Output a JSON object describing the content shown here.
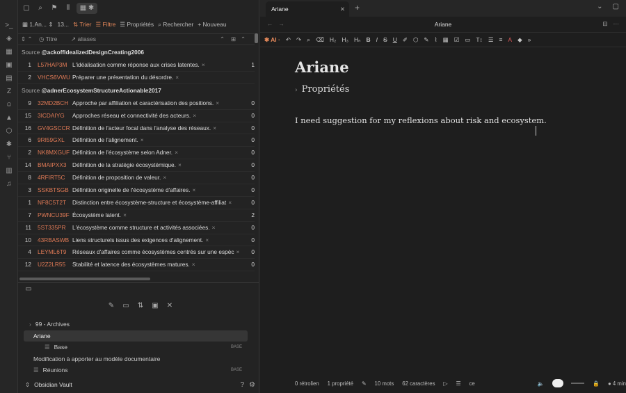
{
  "left_panel": {
    "bases_tab_label": "1.An...",
    "count_label": "13...",
    "toolbar": {
      "sort": "Trier",
      "filter": "Filtre",
      "properties": "Propriétés",
      "search": "Rechercher",
      "new": "Nouveau"
    },
    "columns": {
      "title": "Titre",
      "aliases": "aliases"
    },
    "groups": [
      {
        "source_label": "Source",
        "source_name": "@ackoffIdealizedDesignCreating2006",
        "rows": [
          {
            "n": "1",
            "id": "L57HAP3M",
            "title": "L'idéalisation comme réponse aux crises latentes.",
            "count": "1"
          },
          {
            "n": "2",
            "id": "VHCS6VWU",
            "title": "Préparer une présentation du désordre.",
            "count": ""
          }
        ]
      },
      {
        "source_label": "Source",
        "source_name": "@adnerEcosystemStructureActionable2017",
        "rows": [
          {
            "n": "9",
            "id": "32MD2BCH",
            "title": "Approche par affiliation et caractérisation des positions.",
            "count": "0"
          },
          {
            "n": "15",
            "id": "3ICDAIYG",
            "title": "Approches réseau et connectivité des acteurs.",
            "count": "0"
          },
          {
            "n": "16",
            "id": "GV4GSCCR",
            "title": "Définition de l'acteur focal dans l'analyse des réseaux.",
            "count": "0"
          },
          {
            "n": "6",
            "id": "9RI59GXL",
            "title": "Définition de l'alignement.",
            "count": "0"
          },
          {
            "n": "2",
            "id": "NK8MXGUF",
            "title": "Définition de l'écosystème selon Adner.",
            "count": "0"
          },
          {
            "n": "14",
            "id": "BMAIPXX3",
            "title": "Définition de la stratégie écosystémique.",
            "count": "0"
          },
          {
            "n": "8",
            "id": "4RFIRT5C",
            "title": "Définition de proposition de valeur.",
            "count": "0"
          },
          {
            "n": "3",
            "id": "SSKBTSGB",
            "title": "Définition originelle de l'écosystème d'affaires.",
            "count": "0"
          },
          {
            "n": "1",
            "id": "NF8C5T2T",
            "title": "Distinction entre écosystème-structure et écosystème-affiliat",
            "count": "0"
          },
          {
            "n": "7",
            "id": "PWNCU39F",
            "title": "Écosystème latent.",
            "count": "2"
          },
          {
            "n": "11",
            "id": "5ST335PR",
            "title": "L'écosystème comme structure et activités associées.",
            "count": "0"
          },
          {
            "n": "10",
            "id": "43RBASWB",
            "title": "Liens structurels issus des exigences d'alignement.",
            "count": "0"
          },
          {
            "n": "4",
            "id": "LEYML6T9",
            "title": "Réseaux d'affaires comme écosystèmes centrés sur une espèc",
            "count": "0"
          },
          {
            "n": "12",
            "id": "U2Z2LR55",
            "title": "Stabilité et latence des écosystèmes matures.",
            "count": "0"
          }
        ]
      }
    ],
    "tree": [
      {
        "label": "99 - Archives",
        "badge": "",
        "indent": 1,
        "caret": true,
        "selected": false
      },
      {
        "label": "Ariane",
        "badge": "",
        "indent": 1,
        "caret": false,
        "selected": true
      },
      {
        "label": "Base",
        "badge": "BASE",
        "indent": 3,
        "caret": false,
        "selected": false
      },
      {
        "label": "Modification à apporter au modèle documentaire",
        "badge": "",
        "indent": 1,
        "caret": false,
        "selected": false
      },
      {
        "label": "Réunions",
        "badge": "BASE",
        "indent": 1,
        "caret": false,
        "selected": false
      }
    ],
    "vault_name": "Obsidian Vault"
  },
  "editor": {
    "tab_title": "Ariane",
    "nav_title": "Ariane",
    "ai_label": "AI",
    "heading": "Ariane",
    "properties_label": "Propriétés",
    "paragraph": "I need suggestion for my reflexions about risk and ecosystem.",
    "status": {
      "backlinks": "0 rétrolien",
      "properties": "1 propriété",
      "words": "10 mots",
      "chars": "62 caractères",
      "lang": "ce",
      "read_time": "4 min"
    }
  },
  "colors": {
    "accent": "#e88a5b",
    "id_color": "#e07a56"
  }
}
